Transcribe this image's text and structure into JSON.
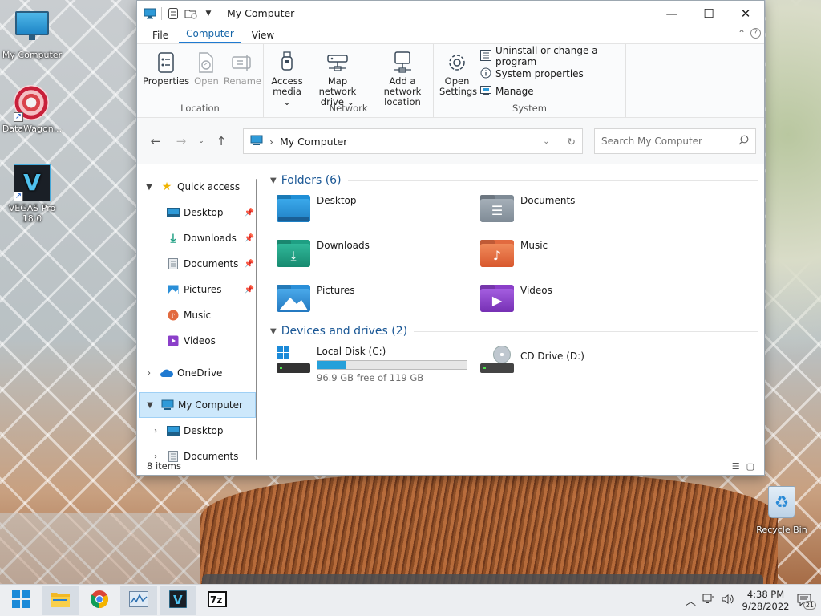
{
  "desktop": {
    "icons": [
      {
        "label": "My Computer"
      },
      {
        "label": "DataWagon..."
      },
      {
        "label": "VEGAS Pro 18.0"
      },
      {
        "label": "Recycle Bin"
      }
    ]
  },
  "window": {
    "title": "My Computer",
    "tabs": [
      "File",
      "Computer",
      "View"
    ],
    "active_tab": "Computer",
    "ribbon": {
      "location": {
        "name": "Location",
        "buttons": [
          {
            "label": "Properties",
            "icon": "properties-icon"
          },
          {
            "label": "Open",
            "icon": "open-icon",
            "disabled": true
          },
          {
            "label": "Rename",
            "icon": "rename-icon",
            "disabled": true
          }
        ]
      },
      "network": {
        "name": "Network",
        "buttons": [
          {
            "label": "Access media ⌄",
            "icon": "usb-media-icon"
          },
          {
            "label": "Map network drive ⌄",
            "icon": "network-drive-icon"
          },
          {
            "label": "Add a network location",
            "icon": "network-location-icon"
          }
        ]
      },
      "system": {
        "name": "System",
        "open_settings": "Open Settings",
        "links": [
          {
            "label": "Uninstall or change a program",
            "icon": "list-icon"
          },
          {
            "label": "System properties",
            "icon": "info-icon"
          },
          {
            "label": "Manage",
            "icon": "manage-icon"
          }
        ]
      }
    },
    "address": {
      "path": "My Computer",
      "search_placeholder": "Search My Computer"
    },
    "tree": [
      {
        "label": "Quick access",
        "level": 0,
        "expanded": true,
        "icon": "star-icon"
      },
      {
        "label": "Desktop",
        "level": 1,
        "pinned": true,
        "icon": "desktop-folder-icon"
      },
      {
        "label": "Downloads",
        "level": 1,
        "pinned": true,
        "icon": "downloads-icon"
      },
      {
        "label": "Documents",
        "level": 1,
        "pinned": true,
        "icon": "documents-icon"
      },
      {
        "label": "Pictures",
        "level": 1,
        "pinned": true,
        "icon": "pictures-icon"
      },
      {
        "label": "Music",
        "level": 1,
        "icon": "music-icon"
      },
      {
        "label": "Videos",
        "level": 1,
        "icon": "videos-icon"
      },
      {
        "label": "OneDrive",
        "level": 0,
        "expanded": false,
        "icon": "cloud-icon"
      },
      {
        "label": "My Computer",
        "level": 0,
        "expanded": true,
        "selected": true,
        "icon": "computer-icon"
      },
      {
        "label": "Desktop",
        "level": 1,
        "expanded": false,
        "icon": "desktop-folder-icon"
      },
      {
        "label": "Documents",
        "level": 1,
        "expanded": false,
        "icon": "documents-icon"
      }
    ],
    "folders_header": "Folders (6)",
    "folders": [
      {
        "label": "Desktop",
        "color": "#1f8fd6",
        "glyph": ""
      },
      {
        "label": "Documents",
        "color": "#7f8b96",
        "glyph": "☰"
      },
      {
        "label": "Downloads",
        "color": "#1e9f83",
        "glyph": "⤓"
      },
      {
        "label": "Music",
        "color": "#e26a3f",
        "glyph": "♪"
      },
      {
        "label": "Pictures",
        "color": "#2a8fd8",
        "glyph": "▲"
      },
      {
        "label": "Videos",
        "color": "#8b3fc9",
        "glyph": "▶"
      }
    ],
    "drives_header": "Devices and drives (2)",
    "drives": [
      {
        "label": "Local Disk (C:)",
        "free": "96.9 GB free of 119 GB",
        "used_fraction": 0.186
      },
      {
        "label": "CD Drive (D:)"
      }
    ],
    "status": "8 items"
  },
  "taskbar": {
    "apps": [
      "start",
      "file-explorer",
      "chrome",
      "monitor",
      "vegas",
      "7zip"
    ],
    "time": "4:38 PM",
    "date": "9/28/2022",
    "notifications": "21"
  }
}
